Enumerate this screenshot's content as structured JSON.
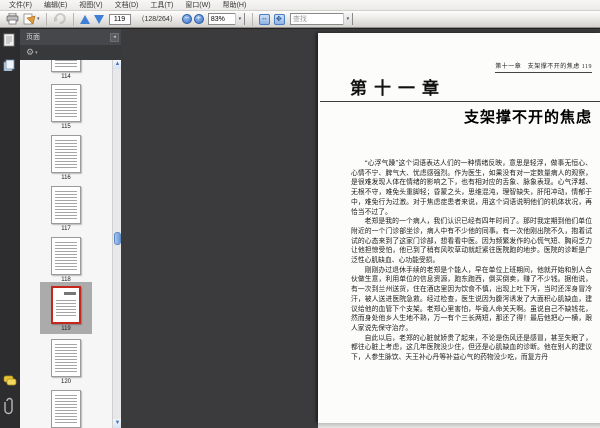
{
  "menu": {
    "items": [
      "文件(F)",
      "编辑(E)",
      "视图(V)",
      "文档(D)",
      "工具(T)",
      "窗口(W)",
      "帮助(H)"
    ]
  },
  "toolbar": {
    "page_number": "119",
    "page_count": "（128/264）",
    "zoom_level": "83%",
    "find_placeholder": "查找",
    "icons": [
      "printer-icon",
      "email-icon",
      "undo-icon",
      "previous-page-icon",
      "next-page-icon",
      "zoom-out-icon",
      "zoom-in-icon",
      "fit-width-icon",
      "fit-page-icon"
    ]
  },
  "sidebar": {
    "panel_title": "页面",
    "rail_icons": [
      "pages-panel-icon",
      "layers-panel-icon",
      "comments-panel-icon",
      "attachments-panel-icon"
    ],
    "thumbnails": [
      "114",
      "115",
      "116",
      "117",
      "118",
      "119",
      "120"
    ],
    "selected_page": "119"
  },
  "document": {
    "running_head": "第十一章　支架撑不开的焦虑 119",
    "chapter_heading": "第十一章",
    "chapter_title": "支架撑不开的焦虑",
    "paragraphs": [
      "“心浮气躁”这个词语表达人们的一种情绪反映，意思是轻浮，做事无恒心、心情不宁、脾气大、忧虑感强烈。作为医生，如果没有对一定数量病人的观察，是很难发现人体在情绪的影响之下，也有相对应的舌象、脉象表现。心气浮越、无根不守，难免头重脚轻；昏蒙之头，思维混沌，理智缺失，肝阳冲动，情郁于中，难免行为过激。对于焦虑症患者来说，用这个词语说明他们的机体状况，再恰当不过了。",
      "老郑是我的一个病人，我们认识已经有四年时间了。那时我定期到他们单位附近的一个门诊部坐诊，病人中有不少他的同事。有一次他刚出院不久，抱着试试的心态来到了这家门诊部，想看看中医。因为频繁发作的心慌气短、胸闷乏力让他担惊受怕，他已到了稍有风吹草动就赶紧往医院跑的地步。医院的诊断是广泛性心肌缺血、心功能受损。",
      "刚刚办过退休手续的老郑是个能人，早在单位上班期间，他就开始和别人合伙做生意，利用单位的信息资源，跑东跑西，倒买倒卖，赚了不少钱。据他说，有一次到兰州送货，住在酒店里因为饮食不慎，出现上吐下泻，当时还浑身冒冷汗，被人送进医院急救。经过检查，医生说因为腹泻诱发了大面积心肌缺血，建议给他的血管下个支架。老郑心里害怕，毕竟人命关天啊。虽说自己不缺钱花，然而身处他乡人生地不熟，万一有个三长两短，那还了得！最后他把心一横，跟人家说先保守治疗。",
      "自此以后，老郑的心脏就娇贵了起来，不论是伤风还是感冒，甚至失眠了，都往心脏上考虑，这几年医院没少住，但还是心肌缺血的诊断。他在别人的建议下，人参生脉饮、天王补心丹等补益心气的药物没少吃，而复方丹"
    ]
  },
  "colors": {
    "accent_blue": "#3f7fd6",
    "selection_red": "#c5271c",
    "pasteboard": "#3b3b3d",
    "comment_yellow": "#e8c437"
  }
}
